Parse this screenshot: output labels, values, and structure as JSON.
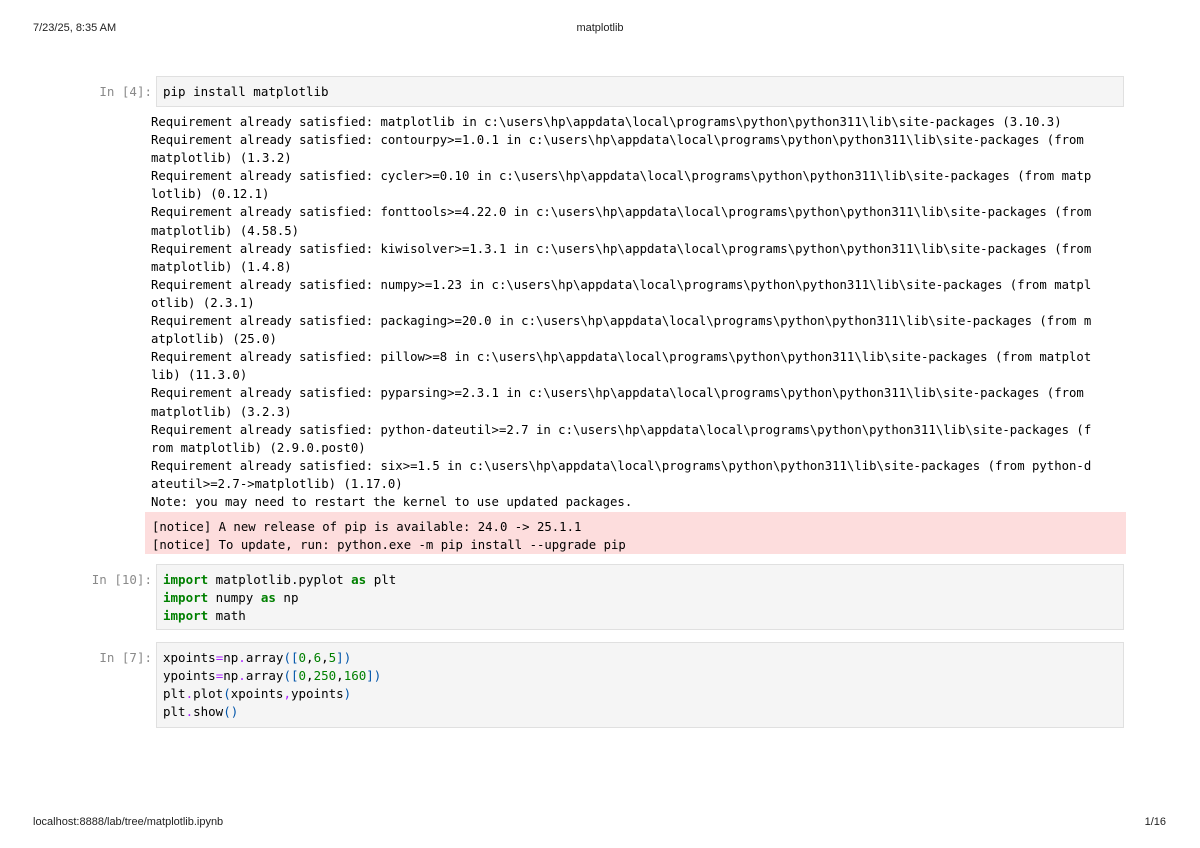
{
  "page": {
    "date": "7/23/25, 8:35 AM",
    "title": "matplotlib",
    "url": "localhost:8888/lab/tree/matplotlib.ipynb",
    "page_number": "1/16"
  },
  "cells": {
    "install": {
      "prompt": "In [4]:",
      "code": "pip install matplotlib",
      "output_lines": [
        "Requirement already satisfied: matplotlib in c:\\users\\hp\\appdata\\local\\programs\\python\\python311\\lib\\site-packages (3.10.3)",
        "Requirement already satisfied: contourpy>=1.0.1 in c:\\users\\hp\\appdata\\local\\programs\\python\\python311\\lib\\site-packages (from",
        "matplotlib) (1.3.2)",
        "Requirement already satisfied: cycler>=0.10 in c:\\users\\hp\\appdata\\local\\programs\\python\\python311\\lib\\site-packages (from matp",
        "lotlib) (0.12.1)",
        "Requirement already satisfied: fonttools>=4.22.0 in c:\\users\\hp\\appdata\\local\\programs\\python\\python311\\lib\\site-packages (from",
        "matplotlib) (4.58.5)",
        "Requirement already satisfied: kiwisolver>=1.3.1 in c:\\users\\hp\\appdata\\local\\programs\\python\\python311\\lib\\site-packages (from",
        "matplotlib) (1.4.8)",
        "Requirement already satisfied: numpy>=1.23 in c:\\users\\hp\\appdata\\local\\programs\\python\\python311\\lib\\site-packages (from matpl",
        "otlib) (2.3.1)",
        "Requirement already satisfied: packaging>=20.0 in c:\\users\\hp\\appdata\\local\\programs\\python\\python311\\lib\\site-packages (from m",
        "atplotlib) (25.0)",
        "Requirement already satisfied: pillow>=8 in c:\\users\\hp\\appdata\\local\\programs\\python\\python311\\lib\\site-packages (from matplot",
        "lib) (11.3.0)",
        "Requirement already satisfied: pyparsing>=2.3.1 in c:\\users\\hp\\appdata\\local\\programs\\python\\python311\\lib\\site-packages (from",
        "matplotlib) (3.2.3)",
        "Requirement already satisfied: python-dateutil>=2.7 in c:\\users\\hp\\appdata\\local\\programs\\python\\python311\\lib\\site-packages (f",
        "rom matplotlib) (2.9.0.post0)",
        "Requirement already satisfied: six>=1.5 in c:\\users\\hp\\appdata\\local\\programs\\python\\python311\\lib\\site-packages (from python-d",
        "ateutil>=2.7->matplotlib) (1.17.0)",
        "Note: you may need to restart the kernel to use updated packages."
      ],
      "notice_lines": [
        "[notice] A new release of pip is available: 24.0 -> 25.1.1",
        "[notice] To update, run: python.exe -m pip install --upgrade pip"
      ]
    },
    "imports": {
      "prompt": "In [10]:",
      "line1": {
        "kw": "import",
        "mod": " matplotlib.pyplot ",
        "as": "as",
        "alias": " plt"
      },
      "line2": {
        "kw": "import",
        "mod": " numpy ",
        "as": "as",
        "alias": " np"
      },
      "line3": {
        "kw": "import",
        "mod": " math"
      }
    },
    "plot": {
      "prompt": "In [7]:",
      "line1": {
        "a": "xpoints",
        "eq": "=",
        "b": "np",
        "dot": ".",
        "c": "array",
        "o": "([",
        "n1": "0",
        "s1": ",",
        "n2": "6",
        "s2": ",",
        "n3": "5",
        "cl": "])"
      },
      "line2": {
        "a": "ypoints",
        "eq": "=",
        "b": "np",
        "dot": ".",
        "c": "array",
        "o": "([",
        "n1": "0",
        "s1": ",",
        "n2": "250",
        "s2": ",",
        "n3": "160",
        "cl": "])"
      },
      "line3": {
        "a": "plt",
        "dot": ".",
        "b": "plot",
        "o": "(",
        "c": "xpoints",
        "s": ",",
        "d": "ypoints",
        "cl": ")"
      },
      "line4": {
        "a": "plt",
        "dot": ".",
        "b": "show",
        "o": "()"
      }
    }
  }
}
